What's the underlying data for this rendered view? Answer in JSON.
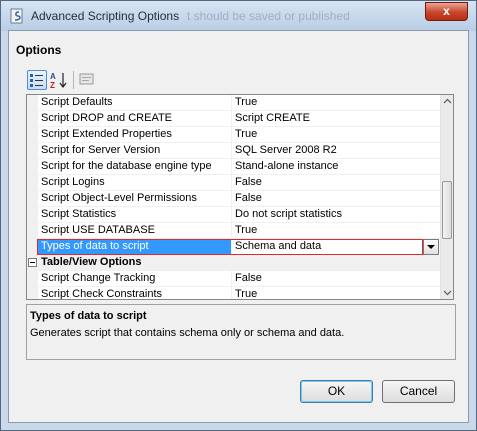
{
  "window": {
    "title": "Advanced Scripting Options",
    "title_overlap": "t should be saved or published",
    "close_glyph": "x"
  },
  "options": {
    "heading": "Options"
  },
  "toolbar": {
    "categorized_icon": "categorized-icon",
    "alphabetical_icon": "alphabetical-sort-icon",
    "property_pages_icon": "property-pages-icon"
  },
  "grid": {
    "rows": [
      {
        "name": "Script Defaults",
        "value": "True"
      },
      {
        "name": "Script DROP and CREATE",
        "value": "Script CREATE"
      },
      {
        "name": "Script Extended Properties",
        "value": "True"
      },
      {
        "name": "Script for Server Version",
        "value": "SQL Server 2008 R2"
      },
      {
        "name": "Script for the database engine type",
        "value": "Stand-alone instance"
      },
      {
        "name": "Script Logins",
        "value": "False"
      },
      {
        "name": "Script Object-Level Permissions",
        "value": "False"
      },
      {
        "name": "Script Statistics",
        "value": "Do not script statistics"
      },
      {
        "name": "Script USE DATABASE",
        "value": "True"
      },
      {
        "name": "Types of data to script",
        "value": "Schema and data"
      }
    ],
    "category": {
      "label": "Table/View Options"
    },
    "rows2": [
      {
        "name": "Script Change Tracking",
        "value": "False"
      },
      {
        "name": "Script Check Constraints",
        "value": "True"
      }
    ]
  },
  "description": {
    "title": "Types of data to script",
    "text": "Generates script that contains schema only or schema and data."
  },
  "buttons": {
    "ok": "OK",
    "cancel": "Cancel"
  },
  "colors": {
    "selection": "#3399ff",
    "highlight_outline": "#e02a2a",
    "close_button": "#c9452a"
  }
}
